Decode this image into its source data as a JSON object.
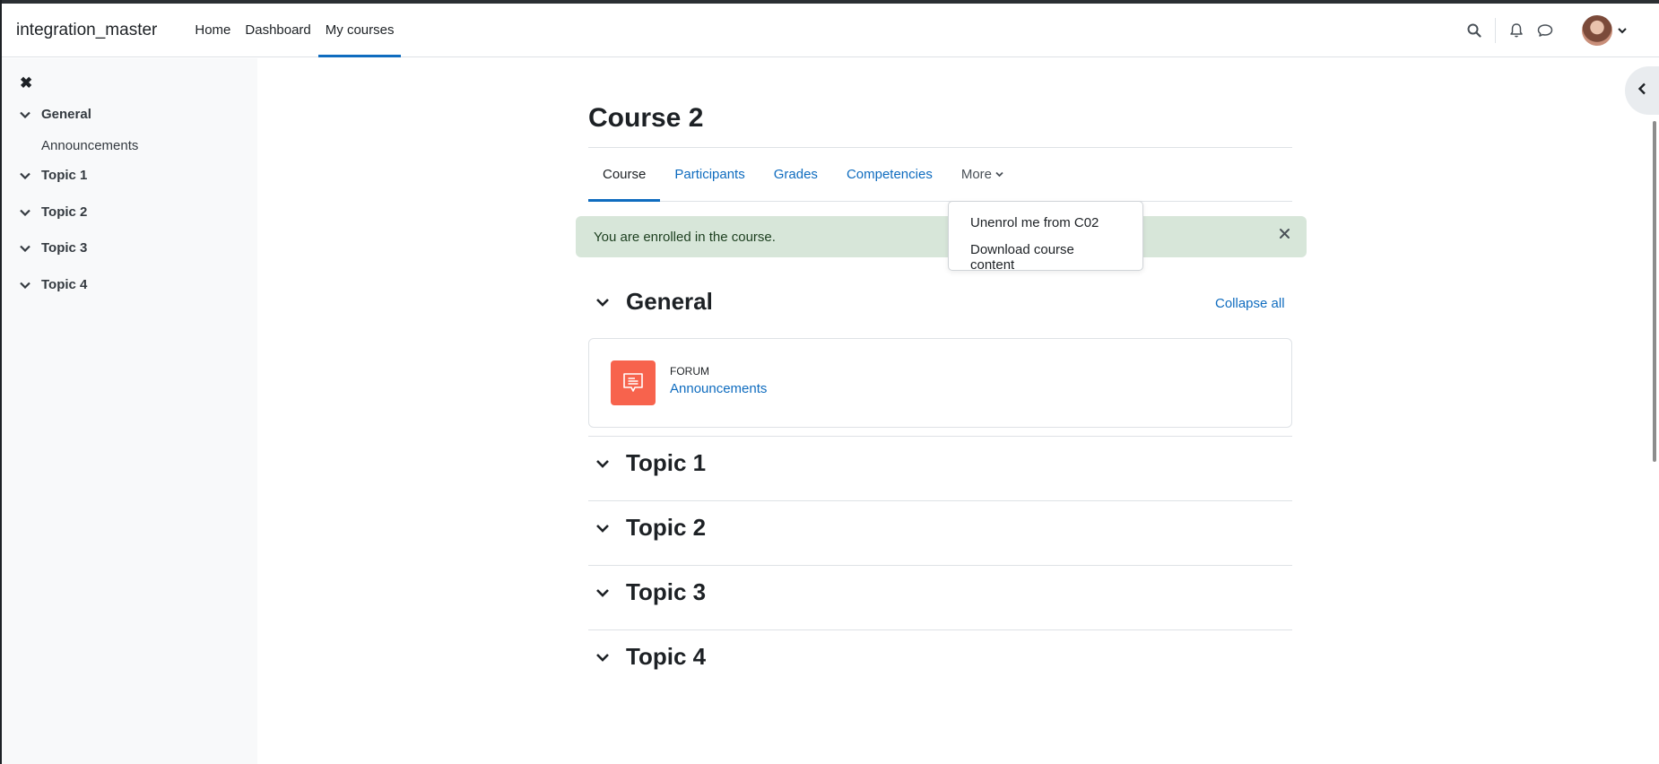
{
  "navbar": {
    "site_name": "integration_master",
    "links": [
      "Home",
      "Dashboard",
      "My courses"
    ],
    "active_link": "My courses"
  },
  "sidebar": {
    "items": [
      {
        "label": "General",
        "children": [
          "Announcements"
        ]
      },
      {
        "label": "Topic 1"
      },
      {
        "label": "Topic 2"
      },
      {
        "label": "Topic 3"
      },
      {
        "label": "Topic 4"
      }
    ]
  },
  "course": {
    "title": "Course 2",
    "tabs": [
      "Course",
      "Participants",
      "Grades",
      "Competencies",
      "More"
    ],
    "active_tab": "Course",
    "more_menu": [
      "Unenrol me from C02",
      "Download course content"
    ]
  },
  "alert": {
    "message": "You are enrolled in the course."
  },
  "sections": {
    "collapse_all": "Collapse all",
    "general": {
      "title": "General",
      "activity": {
        "type": "FORUM",
        "name": "Announcements",
        "icon": "forum-icon"
      }
    },
    "topics": [
      "Topic 1",
      "Topic 2",
      "Topic 3",
      "Topic 4"
    ]
  },
  "colors": {
    "accent": "#0f6cbf",
    "forum_icon_bg": "#f7634d",
    "alert_bg": "#d7e6d9"
  }
}
